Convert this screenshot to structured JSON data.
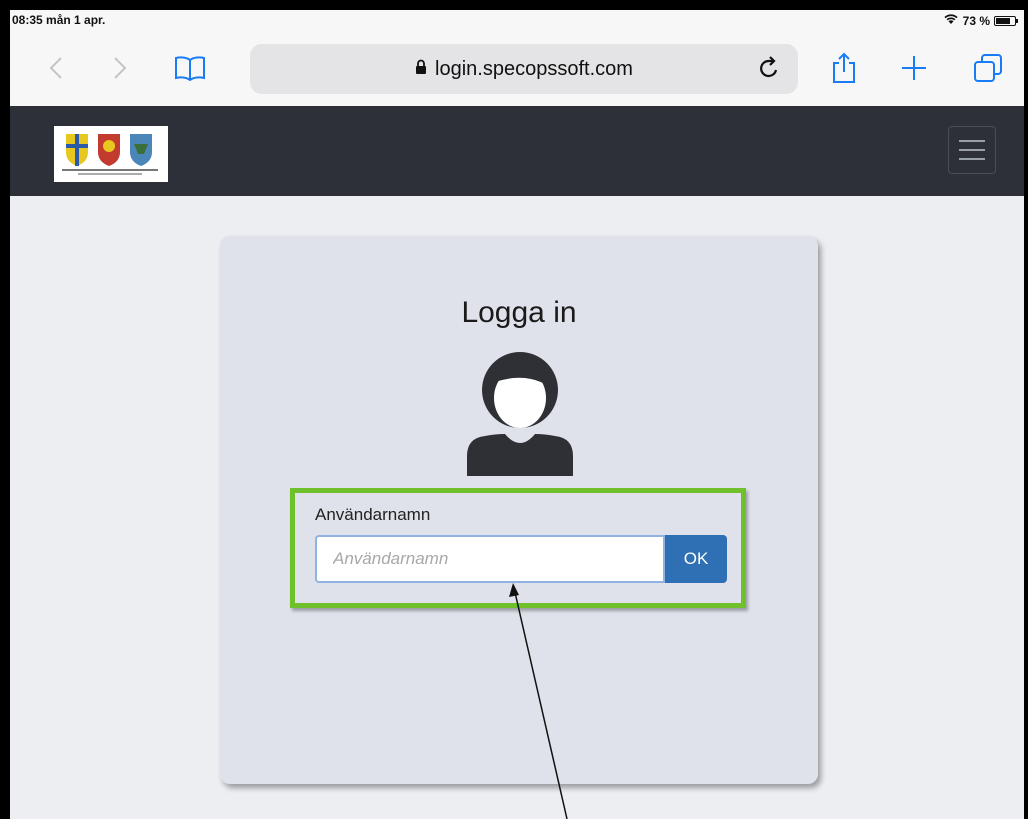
{
  "status_bar": {
    "time": "08:35  mån 1 apr.",
    "battery_text": "73 %"
  },
  "browser": {
    "url": "login.specopssoft.com",
    "icons": [
      "back-icon",
      "forward-icon",
      "bookmarks-icon",
      "lock-icon",
      "reload-icon",
      "share-icon",
      "new-tab-icon",
      "tabs-icon"
    ]
  },
  "header": {
    "logo_icon": "municipal-coats-of-arms-logo",
    "menu_icon": "hamburger-menu-icon",
    "background": "#2d3038"
  },
  "login": {
    "title": "Logga in",
    "avatar_icon": "user-avatar-icon",
    "username_label": "Användarnamn",
    "username_placeholder": "Användarnamn",
    "username_value": "",
    "ok_label": "OK",
    "highlight_color": "#6fc02a",
    "button_color": "#2f6fb3"
  }
}
